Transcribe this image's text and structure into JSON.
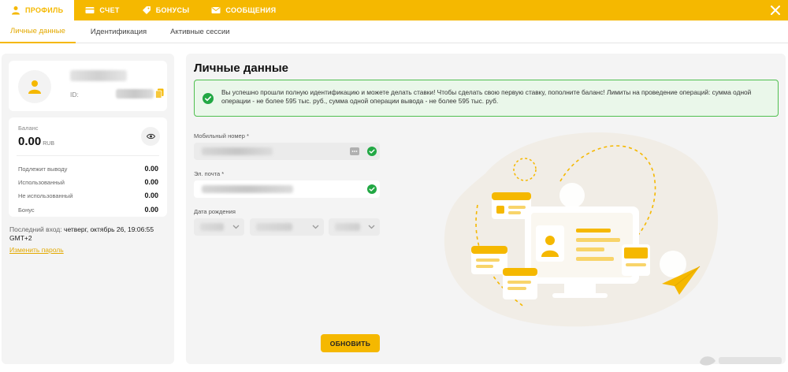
{
  "topnav": {
    "tabs": [
      {
        "label": "ПРОФИЛЬ",
        "icon": "user-icon",
        "active": true
      },
      {
        "label": "СЧЕТ",
        "icon": "card-icon",
        "active": false
      },
      {
        "label": "БОНУСЫ",
        "icon": "tag-icon",
        "active": false
      },
      {
        "label": "СООБЩЕНИЯ",
        "icon": "envelope-icon",
        "active": false
      }
    ],
    "close_icon": "close-icon"
  },
  "subnav": {
    "tabs": [
      {
        "label": "Личные данные",
        "active": true
      },
      {
        "label": "Идентификация",
        "active": false
      },
      {
        "label": "Активные сессии",
        "active": false
      }
    ]
  },
  "sidebar": {
    "id_label": "ID:",
    "balance": {
      "label": "Баланс",
      "amount": "0.00",
      "currency": "RUB",
      "rows": [
        {
          "label": "Подлежит выводу",
          "value": "0.00"
        },
        {
          "label": "Использованный",
          "value": "0.00"
        },
        {
          "label": "Не использованный",
          "value": "0.00"
        },
        {
          "label": "Бонус",
          "value": "0.00"
        }
      ]
    },
    "last_login_label": "Последний вход:",
    "last_login_value": "четверг, октябрь 26, 19:06:55 GMT+2",
    "change_password": "Изменить пароль"
  },
  "main": {
    "title": "Личные данные",
    "alert": "Вы успешно прошли полную идентификацию и можете делать ставки! Чтобы сделать свою первую ставку, пополните баланс! Лимиты на проведение операций: сумма одной операции - не более 595 тыс. руб., сумма одной операции вывода - не более 595 тыс. руб.",
    "phone_label": "Мобильный номер *",
    "email_label": "Эл. почта *",
    "birth_label": "Дата рождения",
    "update_button": "ОБНОВИТЬ"
  },
  "colors": {
    "accent": "#f5b800",
    "success": "#22a844",
    "alert_bg": "#eaf7ea"
  }
}
